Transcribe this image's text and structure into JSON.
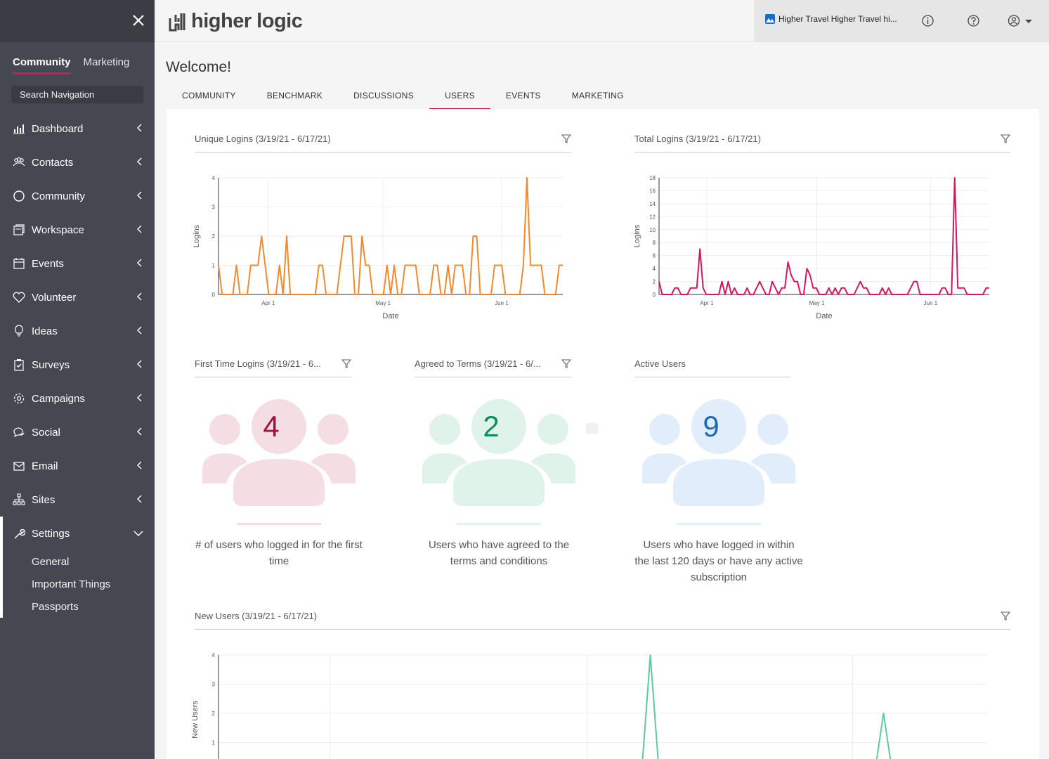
{
  "sidebar": {
    "tabs": [
      "Community",
      "Marketing"
    ],
    "search_placeholder": "Search Navigation",
    "items": [
      {
        "label": "Dashboard",
        "icon": "bar-chart-icon"
      },
      {
        "label": "Contacts",
        "icon": "people-icon"
      },
      {
        "label": "Community",
        "icon": "circle-icon"
      },
      {
        "label": "Workspace",
        "icon": "workspace-icon"
      },
      {
        "label": "Events",
        "icon": "calendar-icon"
      },
      {
        "label": "Volunteer",
        "icon": "heart-icon"
      },
      {
        "label": "Ideas",
        "icon": "lightbulb-icon"
      },
      {
        "label": "Surveys",
        "icon": "clipboard-check-icon"
      },
      {
        "label": "Campaigns",
        "icon": "gear-icon"
      },
      {
        "label": "Social",
        "icon": "chat-icon"
      },
      {
        "label": "Email",
        "icon": "envelope-icon"
      },
      {
        "label": "Sites",
        "icon": "sitemap-icon"
      }
    ],
    "settings": {
      "label": "Settings",
      "icon": "wrench-icon",
      "subitems": [
        "General",
        "Important Things",
        "Passports"
      ]
    }
  },
  "header": {
    "logo_text": "higher logic",
    "site_name": "Higher Travel Higher Travel hi..."
  },
  "main": {
    "welcome": "Welcome!",
    "tabs": [
      "COMMUNITY",
      "BENCHMARK",
      "DISCUSSIONS",
      "USERS",
      "EVENTS",
      "MARKETING"
    ],
    "active_tab": "USERS"
  },
  "cards": {
    "unique_logins_title": "Unique Logins (3/19/21 - 6/17/21)",
    "total_logins_title": "Total Logins (3/19/21 - 6/17/21)",
    "first_time_title": "First Time Logins (3/19/21 - 6...",
    "agreed_title": "Agreed to Terms (3/19/21 - 6/...",
    "active_title": "Active Users",
    "new_users_title": "New Users (3/19/21 - 6/17/21)"
  },
  "stats": {
    "first_time": {
      "value": "4",
      "desc": "# of users who logged in for the first time",
      "color": "#a01444",
      "bg": "#f5dde4"
    },
    "agreed": {
      "value": "2",
      "desc": "Users who have agreed to the terms and conditions",
      "color": "#148a5f",
      "bg": "#dff3ea"
    },
    "active": {
      "value": "9",
      "desc": "Users who have logged in within the last 120 days or have any active subscription",
      "color": "#1f6bb5",
      "bg": "#e1edfa"
    }
  },
  "colors": {
    "accent": "#d6155f",
    "unique_line": "#f08a30",
    "total_line": "#d6155f",
    "new_users_line": "#5fc99a"
  },
  "chart_data": [
    {
      "type": "line",
      "xlabel": "Date",
      "ylabel": "Logins",
      "ylim": [
        0,
        4
      ],
      "yticks": [
        "0",
        "1",
        "2",
        "3",
        "4"
      ],
      "xticks": [
        "Apr 1",
        "May 1",
        "Jun 1"
      ],
      "x_range": [
        "2021-03-19",
        "2021-06-17"
      ],
      "values": [
        1,
        0,
        0,
        0,
        0,
        1,
        0,
        0,
        0,
        1,
        1,
        1,
        2,
        1,
        0,
        0,
        0,
        1,
        0,
        2,
        0,
        0,
        0,
        0,
        0,
        0,
        0,
        0,
        1,
        1,
        0,
        0,
        0,
        0,
        1,
        2,
        2,
        2,
        0,
        0,
        2,
        1,
        1,
        0,
        0,
        0,
        0,
        1,
        0,
        1,
        0,
        0,
        1,
        1,
        1,
        1,
        0,
        0,
        0,
        0,
        1,
        1,
        0,
        0,
        1,
        0,
        1,
        1,
        1,
        0,
        0,
        2,
        2,
        0,
        0,
        0,
        0,
        1,
        1,
        1,
        0,
        0,
        0,
        0,
        0,
        1,
        4,
        1,
        1,
        1,
        1,
        0,
        0,
        0,
        0,
        1,
        1
      ]
    },
    {
      "type": "line",
      "xlabel": "Date",
      "ylabel": "Logins",
      "ylim": [
        0,
        18
      ],
      "yticks": [
        "0",
        "2",
        "4",
        "6",
        "8",
        "10",
        "12",
        "14",
        "16",
        "18"
      ],
      "xticks": [
        "Apr 1",
        "May 1",
        "Jun 1"
      ],
      "x_range": [
        "2021-03-19",
        "2021-06-17"
      ],
      "values": [
        2,
        0,
        0,
        0,
        0,
        1,
        1,
        0,
        0,
        0,
        1,
        1,
        1,
        7,
        1,
        0,
        0,
        0,
        0,
        0,
        2,
        0,
        2,
        0,
        1,
        0,
        0,
        0,
        1,
        0,
        0,
        1,
        2,
        1,
        0,
        0,
        2,
        1,
        0,
        1,
        1,
        5,
        3,
        2,
        2,
        0,
        0,
        4,
        3,
        1,
        1,
        0,
        0,
        0,
        1,
        0,
        1,
        0,
        1,
        1,
        0,
        0,
        0,
        1,
        2,
        1,
        1,
        0,
        0,
        0,
        0,
        1,
        0,
        1,
        0,
        0,
        0,
        0,
        0,
        0,
        1,
        2,
        2,
        0,
        0,
        0,
        0,
        0,
        0,
        0,
        1,
        1,
        0,
        0,
        18,
        1,
        1,
        1,
        0,
        0,
        0,
        0,
        0,
        0,
        1,
        1
      ]
    },
    {
      "type": "line",
      "xlabel": "",
      "ylabel": "New Users",
      "ylim": [
        0,
        4
      ],
      "yticks": [
        "1",
        "2",
        "3",
        "4"
      ],
      "values": [
        0,
        0,
        0,
        0,
        0,
        0,
        0,
        0,
        0,
        0,
        0,
        0,
        0,
        0,
        0,
        0,
        0,
        0,
        0,
        0,
        0,
        0,
        0,
        0,
        0,
        0,
        0,
        0,
        0,
        0,
        0,
        0,
        0,
        0,
        0,
        0,
        0,
        0,
        0,
        0,
        0,
        0,
        0,
        0,
        0,
        0,
        0,
        0,
        0,
        0,
        4,
        0,
        0,
        0,
        0,
        0,
        0,
        0,
        0,
        0,
        0,
        0,
        0,
        0,
        0,
        0,
        0,
        0,
        0,
        0,
        0,
        0,
        0,
        0,
        0,
        0,
        0,
        2,
        0,
        0,
        0,
        0,
        0,
        0,
        0,
        0,
        0,
        0,
        0,
        0
      ]
    }
  ]
}
